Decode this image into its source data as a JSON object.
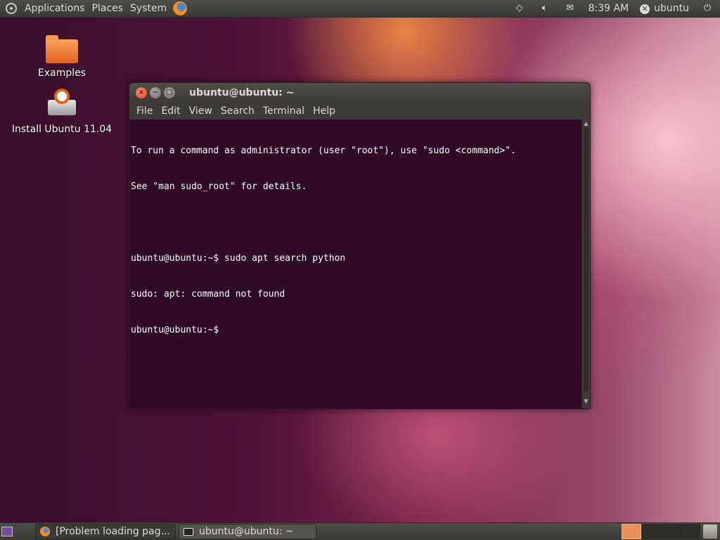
{
  "top_panel": {
    "menus": [
      "Applications",
      "Places",
      "System"
    ],
    "time": "8:39 AM",
    "user": "ubuntu"
  },
  "desktop": {
    "icons": [
      {
        "label": "Examples"
      },
      {
        "label": "Install Ubuntu 11.04"
      }
    ]
  },
  "terminal": {
    "title": "ubuntu@ubuntu: ~",
    "menu": [
      "File",
      "Edit",
      "View",
      "Search",
      "Terminal",
      "Help"
    ],
    "lines": [
      "To run a command as administrator (user \"root\"), use \"sudo <command>\".",
      "See \"man sudo_root\" for details.",
      "",
      "ubuntu@ubuntu:~$ sudo apt search python",
      "sudo: apt: command not found",
      "ubuntu@ubuntu:~$"
    ]
  },
  "taskbar": {
    "tasks": [
      {
        "label": "[Problem loading pag..."
      },
      {
        "label": "ubuntu@ubuntu: ~"
      }
    ]
  },
  "colors": {
    "terminal_bg": "#300a24",
    "panel_bg": "#3c3b37",
    "accent": "#e2621a"
  }
}
